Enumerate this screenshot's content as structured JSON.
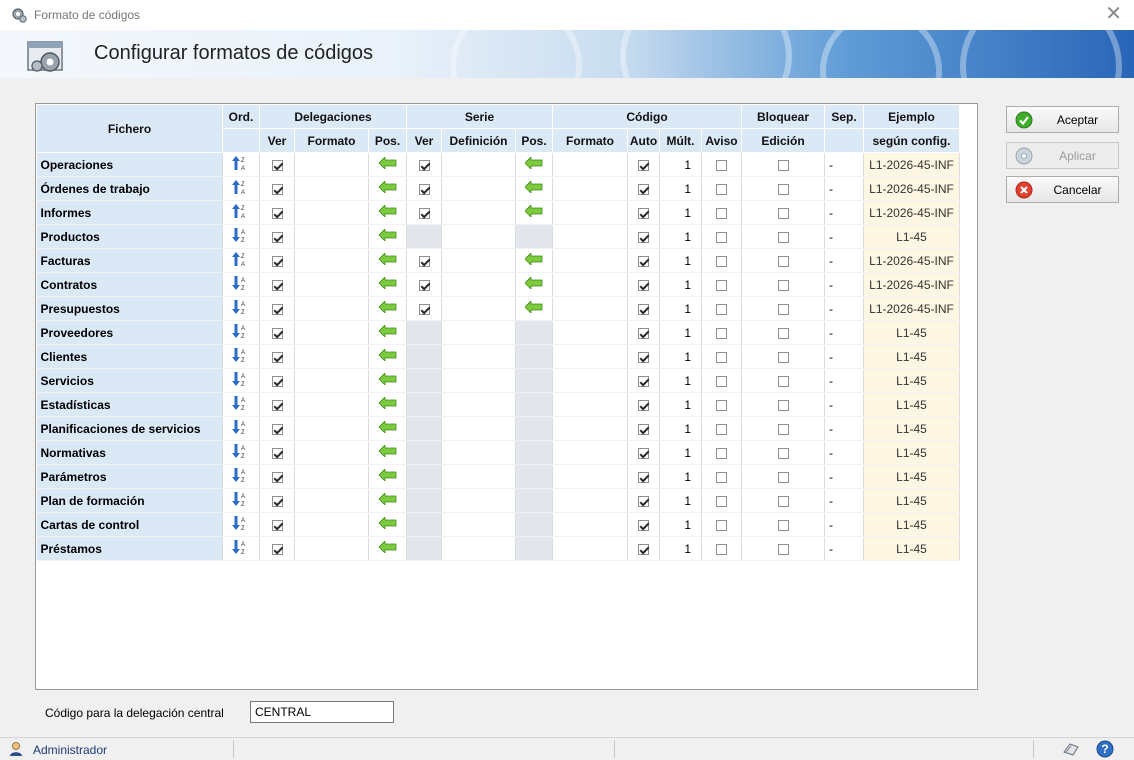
{
  "window": {
    "title": "Formato de códigos",
    "close_icon": "close-icon"
  },
  "banner": {
    "title": "Configurar formatos de códigos"
  },
  "table": {
    "headers": {
      "fichero": "Fichero",
      "ord": "Ord.",
      "delegaciones": "Delegaciones",
      "serie": "Serie",
      "codigo": "Código",
      "bloquear": "Bloquear",
      "sep": "Sep.",
      "ejemplo": "Ejemplo",
      "ver": "Ver",
      "formato": "Formato",
      "pos": "Pos.",
      "definicion": "Definición",
      "auto": "Auto",
      "mult": "Múlt.",
      "aviso": "Aviso",
      "edicion": "Edición",
      "segun_config": "según config."
    },
    "rows": [
      {
        "name": "Operaciones",
        "sort": "desc",
        "del_ver": true,
        "serie": true,
        "serie_ver": true,
        "auto": true,
        "mult": "1",
        "aviso": false,
        "edicion": false,
        "sep": "-",
        "ejemplo": "L1-2026-45-INF"
      },
      {
        "name": "Órdenes de trabajo",
        "sort": "desc",
        "del_ver": true,
        "serie": true,
        "serie_ver": true,
        "auto": true,
        "mult": "1",
        "aviso": false,
        "edicion": false,
        "sep": "-",
        "ejemplo": "L1-2026-45-INF"
      },
      {
        "name": "Informes",
        "sort": "desc",
        "del_ver": true,
        "serie": true,
        "serie_ver": true,
        "auto": true,
        "mult": "1",
        "aviso": false,
        "edicion": false,
        "sep": "-",
        "ejemplo": "L1-2026-45-INF"
      },
      {
        "name": "Productos",
        "sort": "asc",
        "del_ver": true,
        "serie": false,
        "serie_ver": false,
        "auto": true,
        "mult": "1",
        "aviso": false,
        "edicion": false,
        "sep": "-",
        "ejemplo": "L1-45"
      },
      {
        "name": "Facturas",
        "sort": "desc",
        "del_ver": true,
        "serie": true,
        "serie_ver": true,
        "auto": true,
        "mult": "1",
        "aviso": false,
        "edicion": false,
        "sep": "-",
        "ejemplo": "L1-2026-45-INF"
      },
      {
        "name": "Contratos",
        "sort": "asc",
        "del_ver": true,
        "serie": true,
        "serie_ver": true,
        "auto": true,
        "mult": "1",
        "aviso": false,
        "edicion": false,
        "sep": "-",
        "ejemplo": "L1-2026-45-INF"
      },
      {
        "name": "Presupuestos",
        "sort": "asc",
        "del_ver": true,
        "serie": true,
        "serie_ver": true,
        "auto": true,
        "mult": "1",
        "aviso": false,
        "edicion": false,
        "sep": "-",
        "ejemplo": "L1-2026-45-INF"
      },
      {
        "name": "Proveedores",
        "sort": "asc",
        "del_ver": true,
        "serie": false,
        "serie_ver": false,
        "auto": true,
        "mult": "1",
        "aviso": false,
        "edicion": false,
        "sep": "-",
        "ejemplo": "L1-45"
      },
      {
        "name": "Clientes",
        "sort": "asc",
        "del_ver": true,
        "serie": false,
        "serie_ver": false,
        "auto": true,
        "mult": "1",
        "aviso": false,
        "edicion": false,
        "sep": "-",
        "ejemplo": "L1-45"
      },
      {
        "name": "Servicios",
        "sort": "asc",
        "del_ver": true,
        "serie": false,
        "serie_ver": false,
        "auto": true,
        "mult": "1",
        "aviso": false,
        "edicion": false,
        "sep": "-",
        "ejemplo": "L1-45"
      },
      {
        "name": "Estadísticas",
        "sort": "asc",
        "del_ver": true,
        "serie": false,
        "serie_ver": false,
        "auto": true,
        "mult": "1",
        "aviso": false,
        "edicion": false,
        "sep": "-",
        "ejemplo": "L1-45"
      },
      {
        "name": "Planificaciones de servicios",
        "sort": "asc",
        "del_ver": true,
        "serie": false,
        "serie_ver": false,
        "auto": true,
        "mult": "1",
        "aviso": false,
        "edicion": false,
        "sep": "-",
        "ejemplo": "L1-45"
      },
      {
        "name": "Normativas",
        "sort": "asc",
        "del_ver": true,
        "serie": false,
        "serie_ver": false,
        "auto": true,
        "mult": "1",
        "aviso": false,
        "edicion": false,
        "sep": "-",
        "ejemplo": "L1-45"
      },
      {
        "name": "Parámetros",
        "sort": "asc",
        "del_ver": true,
        "serie": false,
        "serie_ver": false,
        "auto": true,
        "mult": "1",
        "aviso": false,
        "edicion": false,
        "sep": "-",
        "ejemplo": "L1-45"
      },
      {
        "name": "Plan de formación",
        "sort": "asc",
        "del_ver": true,
        "serie": false,
        "serie_ver": false,
        "auto": true,
        "mult": "1",
        "aviso": false,
        "edicion": false,
        "sep": "-",
        "ejemplo": "L1-45"
      },
      {
        "name": "Cartas de control",
        "sort": "asc",
        "del_ver": true,
        "serie": false,
        "serie_ver": false,
        "auto": true,
        "mult": "1",
        "aviso": false,
        "edicion": false,
        "sep": "-",
        "ejemplo": "L1-45"
      },
      {
        "name": "Préstamos",
        "sort": "asc",
        "del_ver": true,
        "serie": false,
        "serie_ver": false,
        "auto": true,
        "mult": "1",
        "aviso": false,
        "edicion": false,
        "sep": "-",
        "ejemplo": "L1-45"
      }
    ]
  },
  "buttons": {
    "accept": {
      "label": "Aceptar",
      "icon": "check-icon",
      "enabled": true
    },
    "apply": {
      "label": "Aplicar",
      "icon": "disc-icon",
      "enabled": false
    },
    "cancel": {
      "label": "Cancelar",
      "icon": "cancel-icon",
      "enabled": true
    }
  },
  "central": {
    "label": "Código para la delegación central",
    "value": "CENTRAL"
  },
  "status": {
    "user": "Administrador",
    "user_icon": "user-icon",
    "icons": [
      "printer-icon",
      "help-icon"
    ]
  },
  "colors": {
    "header_bg": "#dbe8f6",
    "example_bg": "#fdf6e2",
    "disabled_cell": "#e3e6ec",
    "arrow_green": "#6fc13a"
  }
}
